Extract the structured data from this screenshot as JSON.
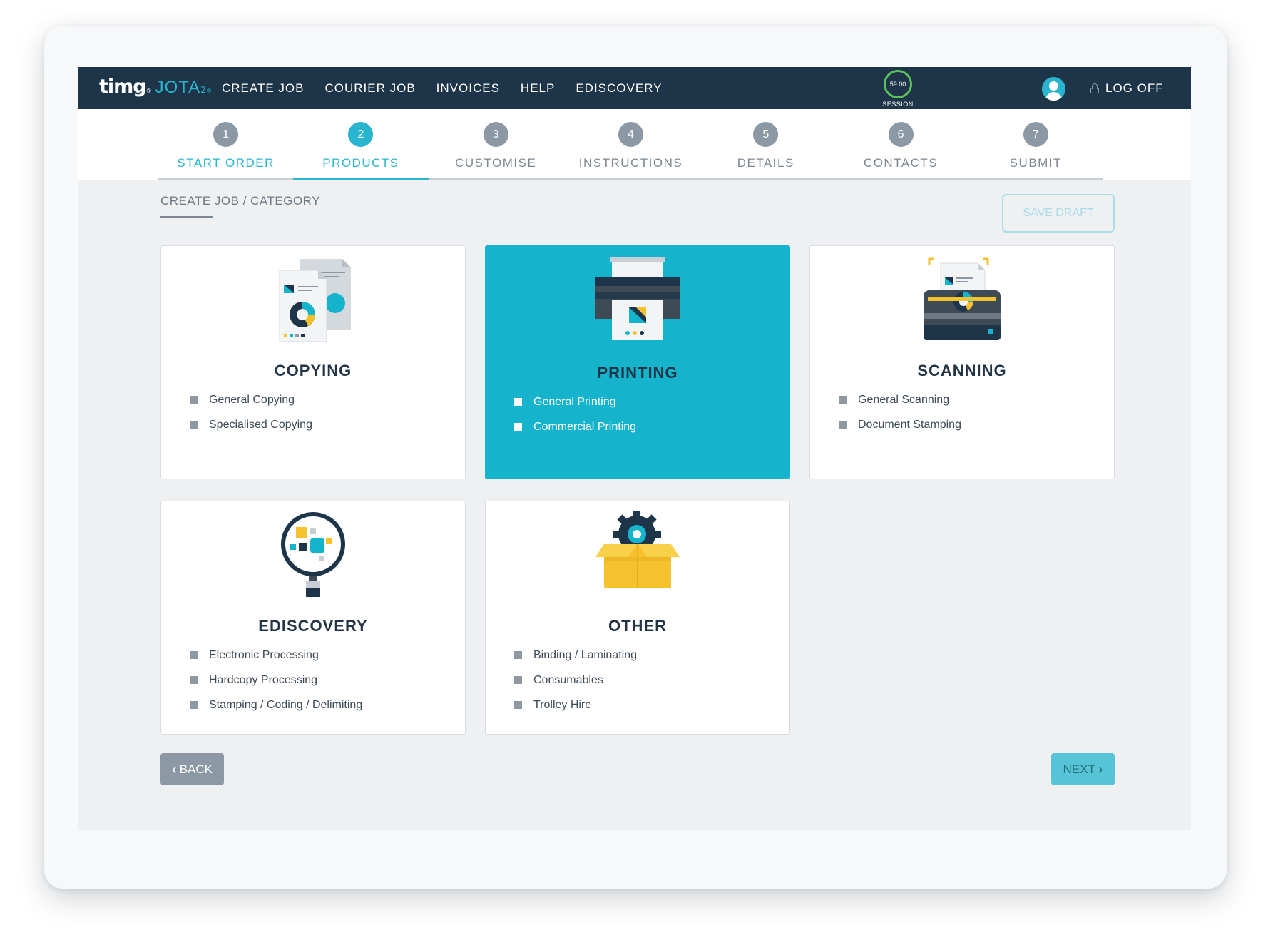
{
  "brand": {
    "name": "timg",
    "product": "JOTA",
    "product_sub": "2"
  },
  "nav": {
    "links": [
      "CREATE JOB",
      "COURIER JOB",
      "INVOICES",
      "HELP",
      "EDISCOVERY"
    ],
    "session_time": "59:00",
    "session_label": "SESSION",
    "logoff_label": "LOG OFF"
  },
  "steps": [
    {
      "num": "1",
      "label": "START ORDER"
    },
    {
      "num": "2",
      "label": "PRODUCTS"
    },
    {
      "num": "3",
      "label": "CUSTOMISE"
    },
    {
      "num": "4",
      "label": "INSTRUCTIONS"
    },
    {
      "num": "5",
      "label": "DETAILS"
    },
    {
      "num": "6",
      "label": "CONTACTS"
    },
    {
      "num": "7",
      "label": "SUBMIT"
    }
  ],
  "breadcrumb": "CREATE JOB / CATEGORY",
  "save_draft_label": "SAVE DRAFT",
  "categories": [
    {
      "title": "COPYING",
      "items": [
        "General Copying",
        "Specialised Copying"
      ]
    },
    {
      "title": "PRINTING",
      "items": [
        "General Printing",
        "Commercial Printing"
      ]
    },
    {
      "title": "SCANNING",
      "items": [
        "General Scanning",
        "Document Stamping"
      ]
    },
    {
      "title": "EDISCOVERY",
      "items": [
        "Electronic Processing",
        "Hardcopy Processing",
        "Stamping / Coding / Delimiting"
      ]
    },
    {
      "title": "OTHER",
      "items": [
        "Binding / Laminating",
        "Consumables",
        "Trolley Hire"
      ]
    }
  ],
  "back_label": "BACK",
  "next_label": "NEXT",
  "colors": {
    "nav_bg": "#1e3549",
    "accent": "#16b3cc",
    "grey_button": "#8c98a4"
  },
  "icons": {
    "copying": "documents-icon",
    "printing": "printer-icon",
    "scanning": "scanner-icon",
    "ediscovery": "magnifier-icon",
    "other": "box-gear-icon"
  }
}
